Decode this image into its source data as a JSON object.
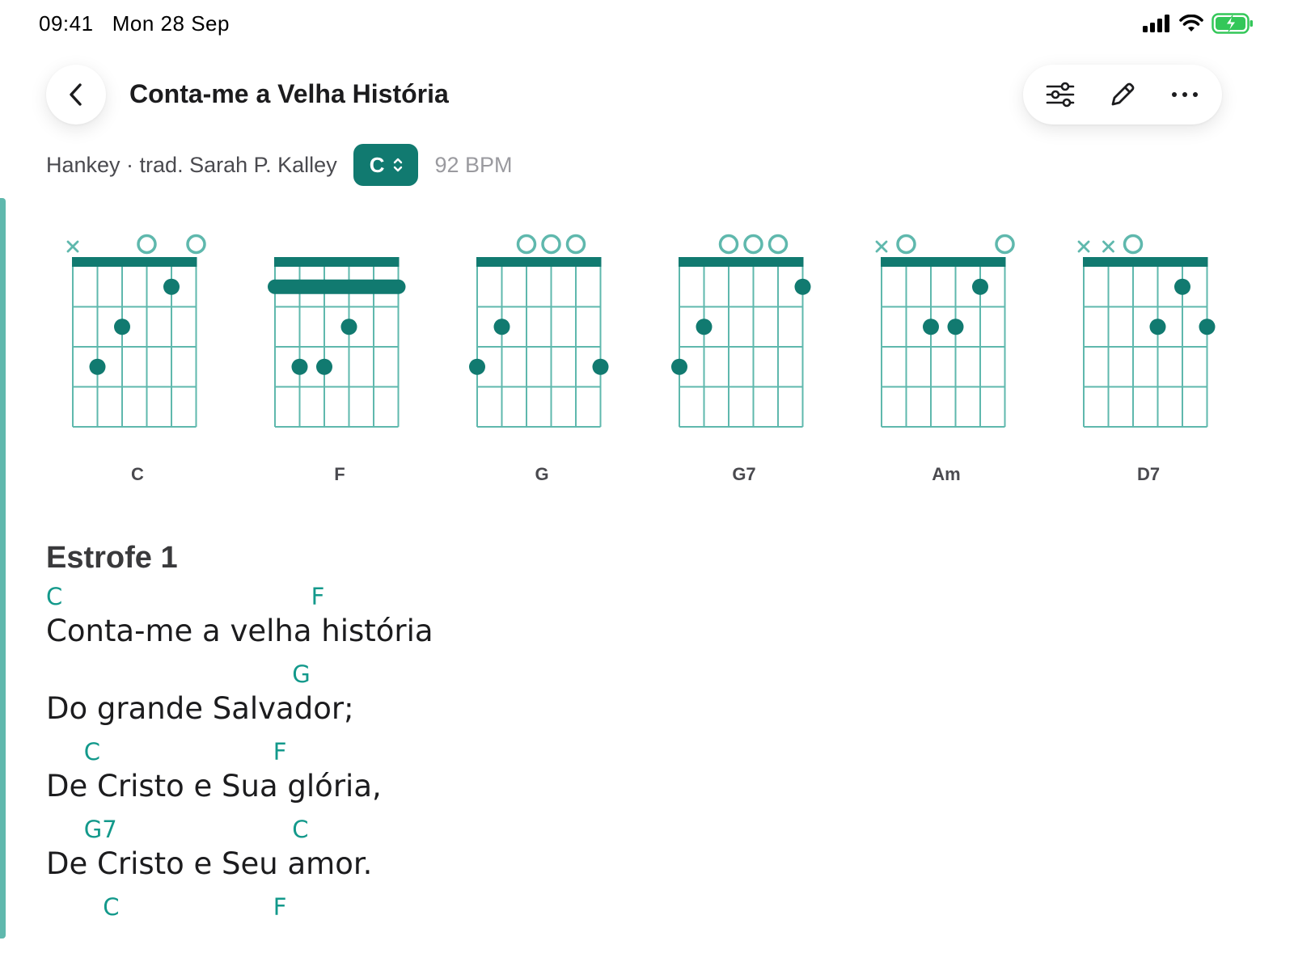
{
  "status": {
    "time": "09:41",
    "date": "Mon 28 Sep",
    "icons": [
      "cellular-signal-icon",
      "wifi-icon",
      "battery-charging-icon"
    ]
  },
  "header": {
    "title": "Conta-me a Velha História",
    "back_icon": "chevron-left-icon",
    "toolbar": [
      "sliders-icon",
      "pencil-icon",
      "more-icon"
    ]
  },
  "meta": {
    "authors": "Hankey · trad. Sarah P. Kalley",
    "key": "C",
    "bpm": "92 BPM"
  },
  "colors": {
    "accent": "#117a70",
    "chord_text": "#13998b",
    "diagram": "#5fb8ad"
  },
  "chord_diagrams": [
    {
      "name": "C",
      "barre": false,
      "markers": [
        "x",
        "",
        "",
        "o",
        "",
        "o"
      ],
      "dots": [
        [
          5,
          3
        ],
        [
          4,
          2
        ],
        [
          2,
          1
        ]
      ]
    },
    {
      "name": "F",
      "barre": true,
      "markers": [
        "",
        "",
        "",
        "",
        "",
        ""
      ],
      "dots": [
        [
          5,
          3
        ],
        [
          4,
          3
        ],
        [
          3,
          2
        ]
      ]
    },
    {
      "name": "G",
      "barre": false,
      "markers": [
        "",
        "",
        "o",
        "o",
        "o",
        ""
      ],
      "dots": [
        [
          6,
          3
        ],
        [
          5,
          2
        ],
        [
          1,
          3
        ]
      ]
    },
    {
      "name": "G7",
      "barre": false,
      "markers": [
        "",
        "",
        "o",
        "o",
        "o",
        ""
      ],
      "dots": [
        [
          6,
          3
        ],
        [
          5,
          2
        ],
        [
          1,
          1
        ]
      ]
    },
    {
      "name": "Am",
      "barre": false,
      "markers": [
        "x",
        "o",
        "",
        "",
        "",
        "o"
      ],
      "dots": [
        [
          4,
          2
        ],
        [
          3,
          2
        ],
        [
          2,
          1
        ]
      ]
    },
    {
      "name": "D7",
      "barre": false,
      "markers": [
        "x",
        "x",
        "o",
        "",
        "",
        ""
      ],
      "dots": [
        [
          3,
          2
        ],
        [
          2,
          1
        ],
        [
          1,
          2
        ]
      ]
    }
  ],
  "section": {
    "title": "Estrofe 1",
    "lines": [
      {
        "chords": [
          {
            "c": "C",
            "col": 0
          },
          {
            "c": "F",
            "col": 14
          }
        ],
        "text": "Conta-me a velha história"
      },
      {
        "chords": [
          {
            "c": "G",
            "col": 13
          }
        ],
        "text": "Do grande Salvador;"
      },
      {
        "chords": [
          {
            "c": "C",
            "col": 2
          },
          {
            "c": "F",
            "col": 12
          }
        ],
        "text": "De Cristo e Sua glória,"
      },
      {
        "chords": [
          {
            "c": "G7",
            "col": 2
          },
          {
            "c": "C",
            "col": 13
          }
        ],
        "text": "De Cristo e Seu amor."
      },
      {
        "chords": [
          {
            "c": "C",
            "col": 3
          },
          {
            "c": "F",
            "col": 12
          }
        ],
        "text": ""
      }
    ]
  }
}
